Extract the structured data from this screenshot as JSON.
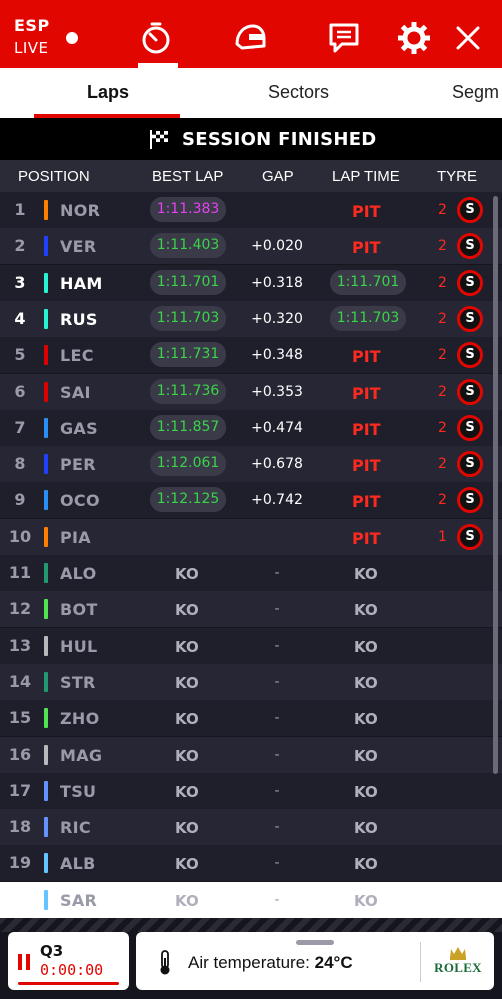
{
  "header": {
    "region": "ESP",
    "status": "LIVE",
    "icons": [
      "stopwatch-icon",
      "helmet-icon",
      "chat-icon",
      "gear-icon",
      "close-icon"
    ]
  },
  "tabs": [
    {
      "label": "Laps",
      "active": true
    },
    {
      "label": "Sectors",
      "active": false
    },
    {
      "label": "Segm",
      "active": false
    }
  ],
  "session": {
    "label": "SESSION FINISHED"
  },
  "columns": {
    "position": "POSITION",
    "best_lap": "BEST LAP",
    "gap": "GAP",
    "lap_time": "LAP TIME",
    "tyre": "TYRE"
  },
  "rows": [
    {
      "pos": "1",
      "driver": "NOR",
      "team_color": "#ff8000",
      "best": "1:11.383",
      "best_purple": true,
      "gap": "",
      "lap": "PIT",
      "laps": "2",
      "tyre": "S",
      "highlight": false
    },
    {
      "pos": "2",
      "driver": "VER",
      "team_color": "#1e41ff",
      "best": "1:11.403",
      "best_purple": false,
      "gap": "+0.020",
      "lap": "PIT",
      "laps": "2",
      "tyre": "S",
      "highlight": false
    },
    {
      "pos": "3",
      "driver": "HAM",
      "team_color": "#27f4d2",
      "best": "1:11.701",
      "best_purple": false,
      "gap": "+0.318",
      "lap": "1:11.701",
      "laps": "2",
      "tyre": "S",
      "highlight": true
    },
    {
      "pos": "4",
      "driver": "RUS",
      "team_color": "#27f4d2",
      "best": "1:11.703",
      "best_purple": false,
      "gap": "+0.320",
      "lap": "1:11.703",
      "laps": "2",
      "tyre": "S",
      "highlight": true
    },
    {
      "pos": "5",
      "driver": "LEC",
      "team_color": "#dc0000",
      "best": "1:11.731",
      "best_purple": false,
      "gap": "+0.348",
      "lap": "PIT",
      "laps": "2",
      "tyre": "S",
      "highlight": false
    },
    {
      "pos": "6",
      "driver": "SAI",
      "team_color": "#dc0000",
      "best": "1:11.736",
      "best_purple": false,
      "gap": "+0.353",
      "lap": "PIT",
      "laps": "2",
      "tyre": "S",
      "highlight": false
    },
    {
      "pos": "7",
      "driver": "GAS",
      "team_color": "#2a8ff5",
      "best": "1:11.857",
      "best_purple": false,
      "gap": "+0.474",
      "lap": "PIT",
      "laps": "2",
      "tyre": "S",
      "highlight": false
    },
    {
      "pos": "8",
      "driver": "PER",
      "team_color": "#1e41ff",
      "best": "1:12.061",
      "best_purple": false,
      "gap": "+0.678",
      "lap": "PIT",
      "laps": "2",
      "tyre": "S",
      "highlight": false
    },
    {
      "pos": "9",
      "driver": "OCO",
      "team_color": "#2a8ff5",
      "best": "1:12.125",
      "best_purple": false,
      "gap": "+0.742",
      "lap": "PIT",
      "laps": "2",
      "tyre": "S",
      "highlight": false
    },
    {
      "pos": "10",
      "driver": "PIA",
      "team_color": "#ff8000",
      "best": "",
      "best_purple": false,
      "gap": "",
      "lap": "PIT",
      "laps": "1",
      "tyre": "S",
      "highlight": false
    },
    {
      "pos": "11",
      "driver": "ALO",
      "team_color": "#229971",
      "best": "KO",
      "gap": "-",
      "lap": "KO"
    },
    {
      "pos": "12",
      "driver": "BOT",
      "team_color": "#52e252",
      "best": "KO",
      "gap": "-",
      "lap": "KO"
    },
    {
      "pos": "13",
      "driver": "HUL",
      "team_color": "#b6babd",
      "best": "KO",
      "gap": "-",
      "lap": "KO"
    },
    {
      "pos": "14",
      "driver": "STR",
      "team_color": "#229971",
      "best": "KO",
      "gap": "-",
      "lap": "KO"
    },
    {
      "pos": "15",
      "driver": "ZHO",
      "team_color": "#52e252",
      "best": "KO",
      "gap": "-",
      "lap": "KO"
    },
    {
      "pos": "16",
      "driver": "MAG",
      "team_color": "#b6babd",
      "best": "KO",
      "gap": "-",
      "lap": "KO"
    },
    {
      "pos": "17",
      "driver": "TSU",
      "team_color": "#6692ff",
      "best": "KO",
      "gap": "-",
      "lap": "KO"
    },
    {
      "pos": "18",
      "driver": "RIC",
      "team_color": "#6692ff",
      "best": "KO",
      "gap": "-",
      "lap": "KO"
    },
    {
      "pos": "19",
      "driver": "ALB",
      "team_color": "#64c4ff",
      "best": "KO",
      "gap": "-",
      "lap": "KO"
    },
    {
      "pos": "",
      "driver": "SAR",
      "team_color": "#64c4ff",
      "best": "KO",
      "gap": "-",
      "lap": "KO"
    }
  ],
  "bottom": {
    "session": "Q3",
    "timer": "0:00:00",
    "air_label": "Air temperature:",
    "air_value": "24°C",
    "sponsor": "ROLEX"
  },
  "colors": {
    "accent": "#e10600",
    "fastest": "#e442f0",
    "personal_best": "#3ad34a"
  }
}
